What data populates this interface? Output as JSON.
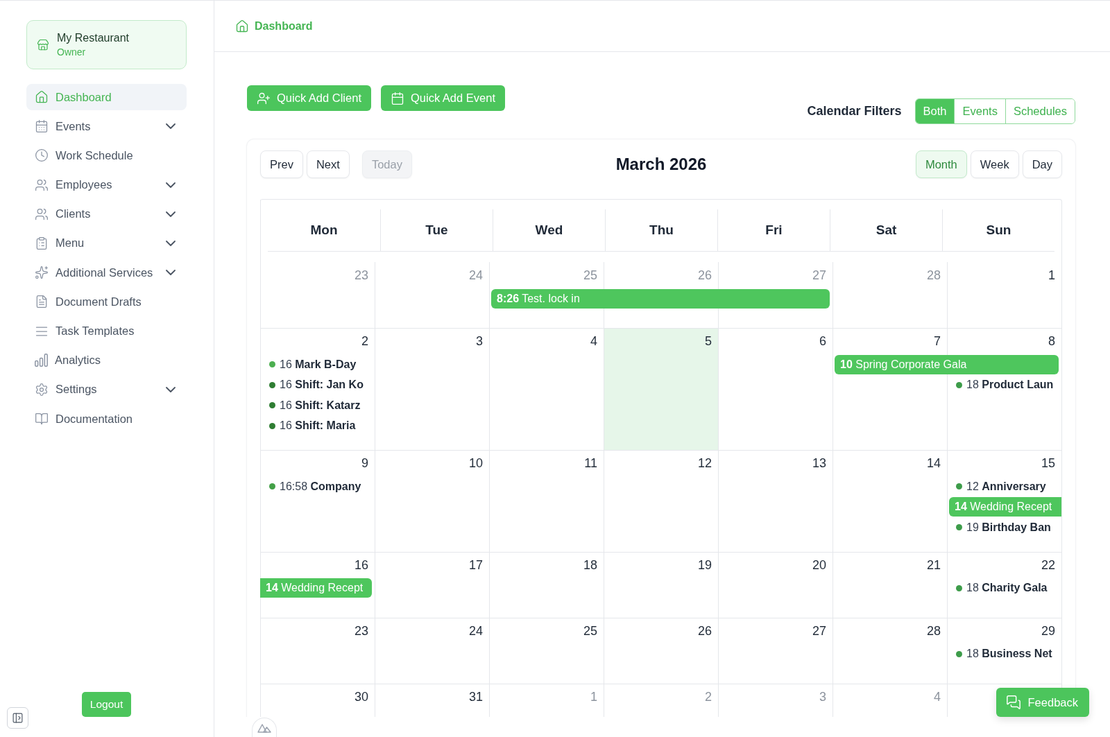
{
  "sidebar": {
    "account": {
      "name": "My Restaurant",
      "role": "Owner"
    },
    "items": [
      {
        "label": "Dashboard",
        "selected": true,
        "expandable": false
      },
      {
        "label": "Events",
        "selected": false,
        "expandable": true
      },
      {
        "label": "Work Schedule",
        "selected": false,
        "expandable": false
      },
      {
        "label": "Employees",
        "selected": false,
        "expandable": true
      },
      {
        "label": "Clients",
        "selected": false,
        "expandable": true
      },
      {
        "label": "Menu",
        "selected": false,
        "expandable": true
      },
      {
        "label": "Additional Services",
        "selected": false,
        "expandable": true
      },
      {
        "label": "Document Drafts",
        "selected": false,
        "expandable": false
      },
      {
        "label": "Task Templates",
        "selected": false,
        "expandable": false
      },
      {
        "label": "Analytics",
        "selected": false,
        "expandable": false
      },
      {
        "label": "Settings",
        "selected": false,
        "expandable": true
      },
      {
        "label": "Documentation",
        "selected": false,
        "expandable": false
      }
    ],
    "logout": "Logout"
  },
  "breadcrumb": {
    "label": "Dashboard"
  },
  "quick_actions": [
    "Quick Add Client",
    "Quick Add Event"
  ],
  "calendar_filters": {
    "title": "Calendar Filters",
    "options": [
      {
        "label": "Both",
        "selected": true
      },
      {
        "label": "Events",
        "selected": false
      },
      {
        "label": "Schedules",
        "selected": false
      }
    ]
  },
  "calendar": {
    "navigation": [
      {
        "label": "Prev",
        "disabled": false
      },
      {
        "label": "Next",
        "disabled": false
      },
      {
        "label": "Today",
        "disabled": true
      }
    ],
    "title": "March 2026",
    "views": [
      {
        "label": "Month",
        "selected": true
      },
      {
        "label": "Week",
        "selected": false
      },
      {
        "label": "Day",
        "selected": false
      }
    ],
    "weekdays": [
      "Mon",
      "Tue",
      "Wed",
      "Thu",
      "Fri",
      "Sat",
      "Sun"
    ],
    "weeks": [
      {
        "days": [
          {
            "date": "23",
            "outside_month": true,
            "today": false
          },
          {
            "date": "24",
            "outside_month": true,
            "today": false
          },
          {
            "date": "25",
            "outside_month": true,
            "today": false,
            "events": [
              {
                "kind": "bar",
                "time": "8:26",
                "title": "Test. lock in"
              }
            ]
          },
          {
            "date": "26",
            "outside_month": true,
            "today": false,
            "events": [
              {
                "kind": "bar_extension"
              }
            ]
          },
          {
            "date": "27",
            "outside_month": true,
            "today": false,
            "events": [
              {
                "kind": "bar_extension"
              }
            ]
          },
          {
            "date": "28",
            "outside_month": true,
            "today": false
          },
          {
            "date": "1",
            "outside_month": false,
            "today": false
          }
        ]
      },
      {
        "days": [
          {
            "date": "2",
            "outside_month": false,
            "today": false,
            "events": [
              {
                "kind": "dot",
                "time": "16",
                "title": "Mark B-Day",
                "color": "#4caf50"
              },
              {
                "kind": "dot",
                "time": "16",
                "title": "Shift: Jan Ko",
                "color": "#2e7d32"
              },
              {
                "kind": "dot",
                "time": "16",
                "title": "Shift: Katarz",
                "color": "#2e7d32"
              },
              {
                "kind": "dot",
                "time": "16",
                "title": "Shift: Maria",
                "color": "#2e7d32"
              }
            ]
          },
          {
            "date": "3",
            "outside_month": false,
            "today": false
          },
          {
            "date": "4",
            "outside_month": false,
            "today": false
          },
          {
            "date": "5",
            "outside_month": false,
            "today": true
          },
          {
            "date": "6",
            "outside_month": false,
            "today": false
          },
          {
            "date": "7",
            "outside_month": false,
            "today": false,
            "events": [
              {
                "kind": "bar",
                "time": "10",
                "title": "Spring Corporate Gala"
              }
            ]
          },
          {
            "date": "8",
            "outside_month": false,
            "today": false,
            "events": [
              {
                "kind": "bar_extension"
              },
              {
                "kind": "dot",
                "time": "18",
                "title": "Product Laun",
                "color": "#3d9c4a"
              }
            ]
          }
        ]
      },
      {
        "days": [
          {
            "date": "9",
            "outside_month": false,
            "today": false,
            "events": [
              {
                "kind": "dot",
                "time": "16:58",
                "title": "Company",
                "color": "#43a047"
              }
            ]
          },
          {
            "date": "10",
            "outside_month": false,
            "today": false
          },
          {
            "date": "11",
            "outside_month": false,
            "today": false
          },
          {
            "date": "12",
            "outside_month": false,
            "today": false
          },
          {
            "date": "13",
            "outside_month": false,
            "today": false
          },
          {
            "date": "14",
            "outside_month": false,
            "today": false
          },
          {
            "date": "15",
            "outside_month": false,
            "today": false,
            "events": [
              {
                "kind": "dot",
                "time": "12",
                "title": "Anniversary",
                "color": "#3d9c4a"
              },
              {
                "kind": "bar_to_next_week",
                "time": "14",
                "title": "Wedding Recept"
              },
              {
                "kind": "dot",
                "time": "19",
                "title": "Birthday Ban",
                "color": "#3d9c4a"
              }
            ]
          }
        ]
      },
      {
        "days": [
          {
            "date": "16",
            "outside_month": false,
            "today": false,
            "events": [
              {
                "kind": "bar_from_last_week",
                "time": "14",
                "title": "Wedding Recept"
              }
            ]
          },
          {
            "date": "17",
            "outside_month": false,
            "today": false
          },
          {
            "date": "18",
            "outside_month": false,
            "today": false
          },
          {
            "date": "19",
            "outside_month": false,
            "today": false
          },
          {
            "date": "20",
            "outside_month": false,
            "today": false
          },
          {
            "date": "21",
            "outside_month": false,
            "today": false
          },
          {
            "date": "22",
            "outside_month": false,
            "today": false,
            "events": [
              {
                "kind": "dot",
                "time": "18",
                "title": "Charity Gala",
                "color": "#3d9c4a"
              }
            ]
          }
        ]
      },
      {
        "days": [
          {
            "date": "23",
            "outside_month": false,
            "today": false
          },
          {
            "date": "24",
            "outside_month": false,
            "today": false
          },
          {
            "date": "25",
            "outside_month": false,
            "today": false
          },
          {
            "date": "26",
            "outside_month": false,
            "today": false
          },
          {
            "date": "27",
            "outside_month": false,
            "today": false
          },
          {
            "date": "28",
            "outside_month": false,
            "today": false
          },
          {
            "date": "29",
            "outside_month": false,
            "today": false,
            "events": [
              {
                "kind": "dot",
                "time": "18",
                "title": "Business Net",
                "color": "#3d9c4a"
              }
            ]
          }
        ]
      },
      {
        "days": [
          {
            "date": "30",
            "outside_month": false,
            "today": false
          },
          {
            "date": "31",
            "outside_month": false,
            "today": false
          },
          {
            "date": "1",
            "outside_month": true,
            "today": false
          },
          {
            "date": "2",
            "outside_month": true,
            "today": false
          },
          {
            "date": "3",
            "outside_month": true,
            "today": false
          },
          {
            "date": "4",
            "outside_month": true,
            "today": false
          },
          {
            "today": false
          }
        ]
      }
    ]
  },
  "feedback": {
    "label": "Feedback"
  }
}
